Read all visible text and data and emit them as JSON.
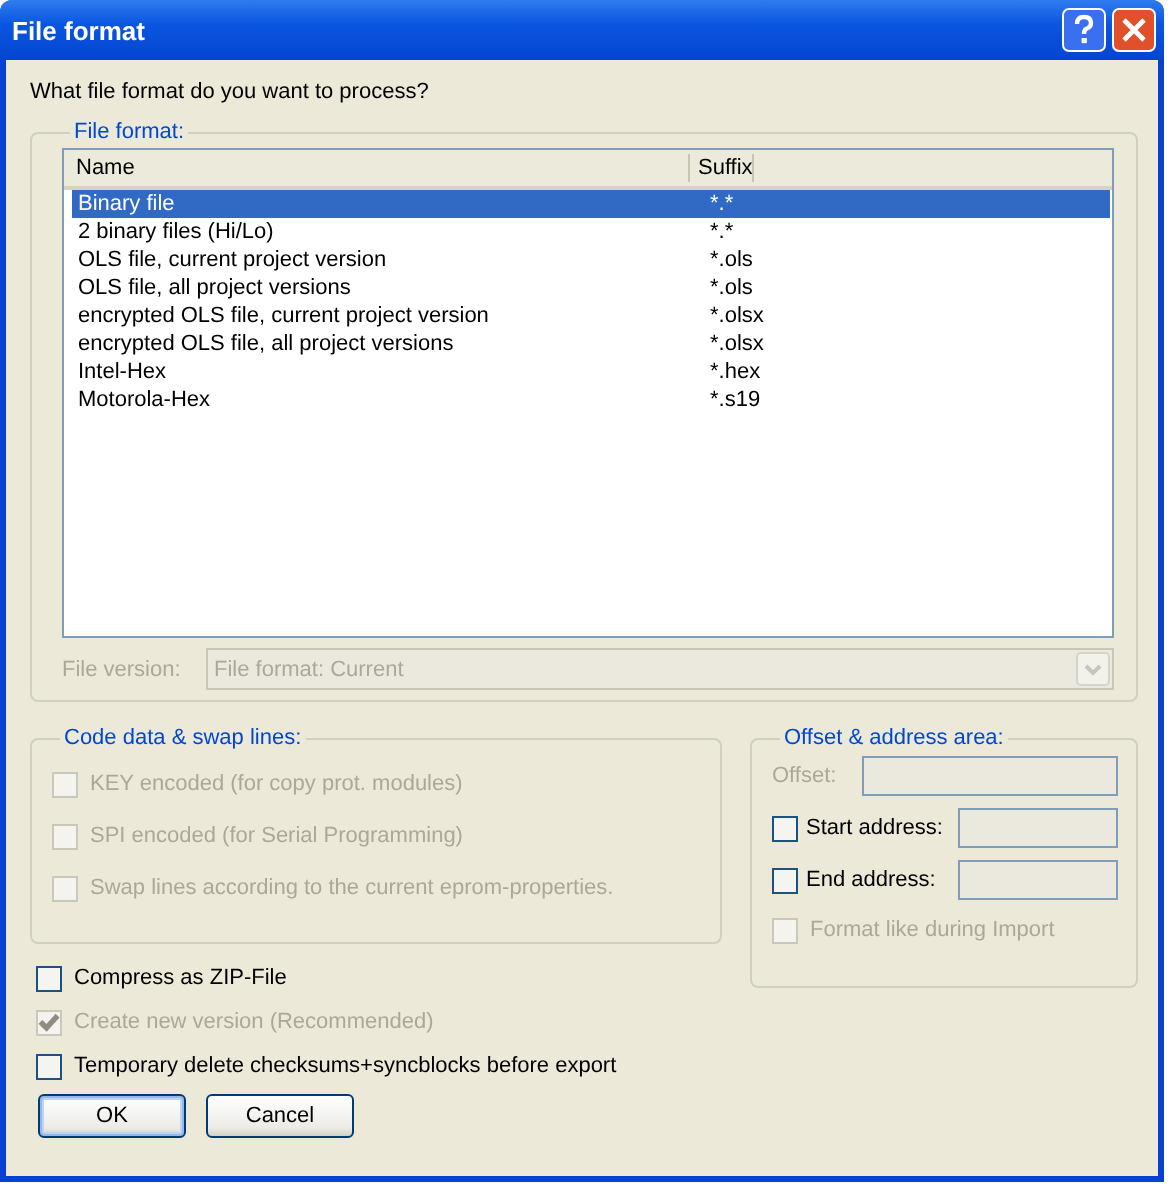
{
  "window": {
    "title": "File format"
  },
  "prompt": "What file format do you want to process?",
  "file_format_group": {
    "title": "File format:",
    "columns": [
      "Name",
      "Suffix"
    ],
    "rows": [
      {
        "name": "Binary file",
        "suffix": "*.*",
        "selected": true
      },
      {
        "name": "2 binary files (Hi/Lo)",
        "suffix": "*.*",
        "selected": false
      },
      {
        "name": "OLS file, current project version",
        "suffix": "*.ols",
        "selected": false
      },
      {
        "name": "OLS file, all project versions",
        "suffix": "*.ols",
        "selected": false
      },
      {
        "name": "encrypted OLS file, current project version",
        "suffix": "*.olsx",
        "selected": false
      },
      {
        "name": "encrypted OLS file, all project versions",
        "suffix": "*.olsx",
        "selected": false
      },
      {
        "name": "Intel-Hex",
        "suffix": "*.hex",
        "selected": false
      },
      {
        "name": "Motorola-Hex",
        "suffix": "*.s19",
        "selected": false
      }
    ],
    "file_version": {
      "label": "File version:",
      "value": "File format: Current",
      "disabled": true
    }
  },
  "code_group": {
    "title": "Code data & swap lines:",
    "options": [
      {
        "label": "KEY encoded (for copy prot. modules)",
        "checked": false,
        "disabled": true
      },
      {
        "label": "SPI encoded (for Serial Programming)",
        "checked": false,
        "disabled": true
      },
      {
        "label": "Swap lines according to the current eprom-properties.",
        "checked": false,
        "disabled": true
      }
    ]
  },
  "offset_group": {
    "title": "Offset & address area:",
    "fields": [
      {
        "kind": "plain",
        "label": "Offset:",
        "disabled": true
      },
      {
        "kind": "checkbox",
        "label": "Start address:",
        "checked": false,
        "disabled": false
      },
      {
        "kind": "checkbox",
        "label": "End address:",
        "checked": false,
        "disabled": false
      }
    ],
    "format_option": {
      "label": "Format like during Import",
      "checked": false,
      "disabled": true
    }
  },
  "options": [
    {
      "label": "Compress as ZIP-File",
      "checked": false,
      "disabled": false
    },
    {
      "label": "Create new version (Recommended)",
      "checked": true,
      "disabled": true
    },
    {
      "label": "Temporary delete checksums+syncblocks before export",
      "checked": false,
      "disabled": false
    }
  ],
  "buttons": [
    {
      "label": "OK",
      "default": true
    },
    {
      "label": "Cancel",
      "default": false
    }
  ]
}
